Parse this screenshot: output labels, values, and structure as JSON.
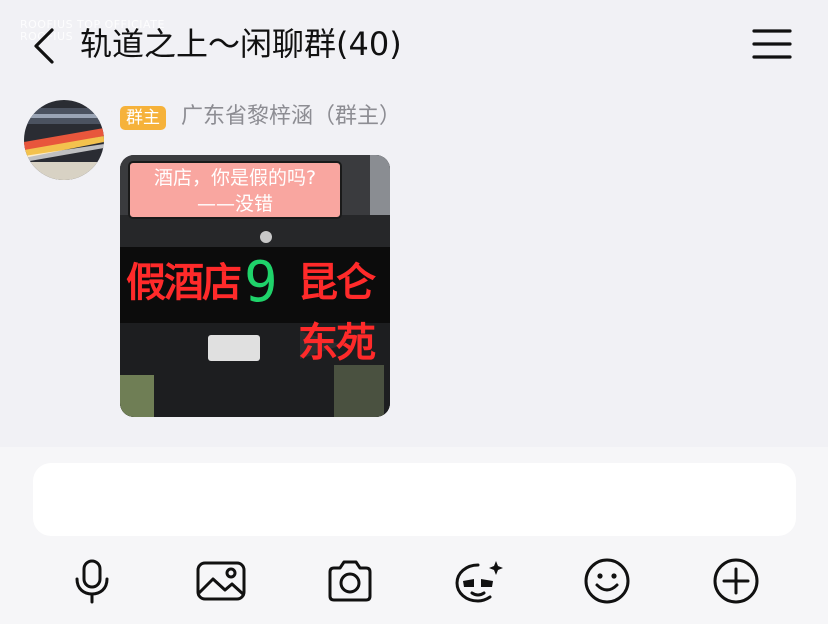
{
  "header": {
    "watermark_lines": [
      "ROOFIUS TOP OFFICIATE",
      "ROOFIUS"
    ],
    "title": "轨道之上～闲聊群(40)",
    "back_icon": "chevron-left-icon",
    "menu_icon": "hamburger-menu-icon"
  },
  "message": {
    "role_badge": "群主",
    "sender": "广东省黎梓涵（群主）",
    "image": {
      "caption_line1": "酒店，你是假的吗?",
      "caption_line2": "——没错",
      "led_left": "假酒店",
      "led_number": "9",
      "led_right": "昆仑东苑"
    }
  },
  "input": {
    "value": "",
    "placeholder": ""
  },
  "toolbar": [
    {
      "icon": "microphone-icon"
    },
    {
      "icon": "image-icon"
    },
    {
      "icon": "camera-icon"
    },
    {
      "icon": "sticker-icon"
    },
    {
      "icon": "emoji-icon"
    },
    {
      "icon": "plus-circle-icon"
    }
  ],
  "colors": {
    "background": "#f1f1f5",
    "badge": "#f6b23a",
    "led_red": "#ff2a2a",
    "led_green": "#1fd36a",
    "caption_bg": "#f9a6a0"
  }
}
